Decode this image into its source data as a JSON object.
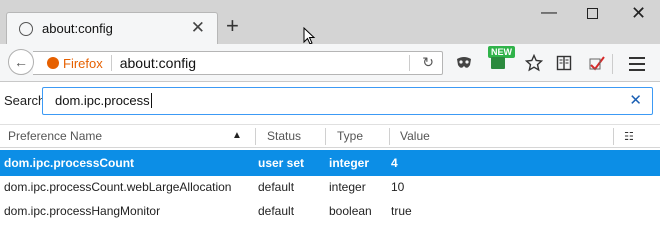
{
  "tab": {
    "title": "about:config",
    "close_glyph": "✕"
  },
  "newtab_glyph": "+",
  "window": {
    "minimize_glyph": "—",
    "close_glyph": "✕"
  },
  "nav": {
    "back_glyph": "←",
    "identity_label": "Firefox",
    "url": "about:config",
    "reload_glyph": "↻",
    "new_badge": "NEW"
  },
  "search": {
    "label": "Search:",
    "value": "dom.ipc.process",
    "clear_glyph": "✕"
  },
  "table": {
    "columns": [
      "Preference Name",
      "Status",
      "Type",
      "Value"
    ],
    "rows": [
      {
        "name": "dom.ipc.processCount",
        "status": "user set",
        "type": "integer",
        "value": "4",
        "selected": true
      },
      {
        "name": "dom.ipc.processCount.webLargeAllocation",
        "status": "default",
        "type": "integer",
        "value": "10",
        "selected": false
      },
      {
        "name": "dom.ipc.processHangMonitor",
        "status": "default",
        "type": "boolean",
        "value": "true",
        "selected": false
      }
    ]
  },
  "colors": {
    "accent": "#0c8ee6",
    "firefox": "#e66000",
    "search_border": "#3c9af5"
  }
}
